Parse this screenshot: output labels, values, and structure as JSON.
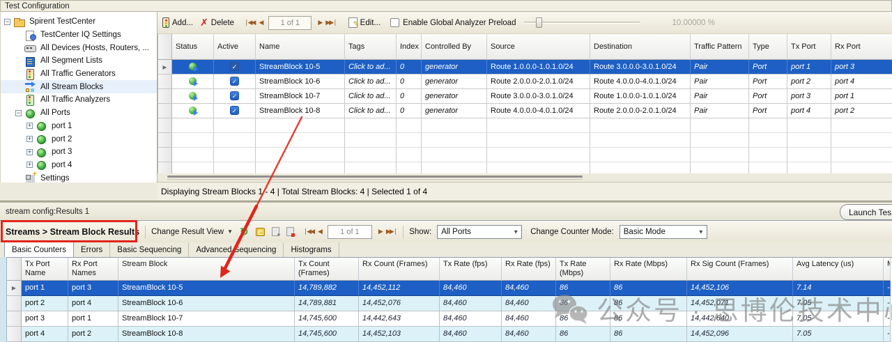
{
  "colors": {
    "selection_blue": "#1d5fc4",
    "alt_row_cyan": "#dcf2f8",
    "annotation_red": "#e1251b",
    "chrome_beige": "#eceadc",
    "watermark_gray": "#7f7f7f",
    "status_green": "#3cb043",
    "checkbox_blue": "#2a6bd0"
  },
  "config_panel": {
    "title": "Test Configuration",
    "tree": {
      "items": [
        {
          "label": "Spirent TestCenter",
          "icon": "folder",
          "level": 0,
          "exp": "minus",
          "selected": false
        },
        {
          "label": "TestCenter IQ Settings",
          "icon": "docgear",
          "level": 1,
          "exp": "",
          "selected": false
        },
        {
          "label": "All Devices (Hosts, Routers, ...",
          "icon": "devices",
          "level": 1,
          "exp": "",
          "selected": false
        },
        {
          "label": "All Segment Lists",
          "icon": "segments",
          "level": 1,
          "exp": "",
          "selected": false
        },
        {
          "label": "All Traffic Generators",
          "icon": "traffic",
          "level": 1,
          "exp": "",
          "selected": false
        },
        {
          "label": "All Stream Blocks",
          "icon": "stream",
          "level": 1,
          "exp": "",
          "selected": true
        },
        {
          "label": "All Traffic Analyzers",
          "icon": "analyzer",
          "level": 1,
          "exp": "",
          "selected": false
        },
        {
          "label": "All Ports",
          "icon": "port",
          "level": 1,
          "exp": "minus",
          "selected": false
        },
        {
          "label": "port 1",
          "icon": "port",
          "level": 2,
          "exp": "plus",
          "selected": false
        },
        {
          "label": "port 2",
          "icon": "port",
          "level": 2,
          "exp": "plus",
          "selected": false
        },
        {
          "label": "port 3",
          "icon": "port",
          "level": 2,
          "exp": "plus",
          "selected": false
        },
        {
          "label": "port 4",
          "icon": "port",
          "level": 2,
          "exp": "plus",
          "selected": false
        },
        {
          "label": "Settings",
          "icon": "settings",
          "level": 1,
          "exp": "",
          "selected": false
        }
      ]
    },
    "toolbar": {
      "add_label": "Add...",
      "delete_label": "Delete",
      "page": "1 of 1",
      "edit_label": "Edit...",
      "preload_label": "Enable Global Analyzer Preload",
      "percent": "10.00000 %"
    },
    "table": {
      "columns": [
        "Status",
        "Active",
        "Name",
        "Tags",
        "Index",
        "Controlled By",
        "Source",
        "Destination",
        "Traffic Pattern",
        "Type",
        "Tx Port",
        "Rx Port"
      ],
      "rows": [
        {
          "name": "StreamBlock 10-5",
          "tags": "Click to ad...",
          "index": "0",
          "controlled_by": "generator",
          "source": "Route 1.0.0.0-1.0.1.0/24",
          "destination": "Route 3.0.0.0-3.0.1.0/24",
          "pattern": "Pair",
          "type": "Port",
          "tx_port": "port 1",
          "rx_port": "port 3",
          "active": true,
          "selected": true
        },
        {
          "name": "StreamBlock 10-6",
          "tags": "Click to ad...",
          "index": "0",
          "controlled_by": "generator",
          "source": "Route 2.0.0.0-2.0.1.0/24",
          "destination": "Route 4.0.0.0-4.0.1.0/24",
          "pattern": "Pair",
          "type": "Port",
          "tx_port": "port 2",
          "rx_port": "port 4",
          "active": true,
          "selected": false
        },
        {
          "name": "StreamBlock 10-7",
          "tags": "Click to ad...",
          "index": "0",
          "controlled_by": "generator",
          "source": "Route 3.0.0.0-3.0.1.0/24",
          "destination": "Route 1.0.0.0-1.0.1.0/24",
          "pattern": "Pair",
          "type": "Port",
          "tx_port": "port 3",
          "rx_port": "port 1",
          "active": true,
          "selected": false
        },
        {
          "name": "StreamBlock 10-8",
          "tags": "Click to ad...",
          "index": "0",
          "controlled_by": "generator",
          "source": "Route 4.0.0.0-4.0.1.0/24",
          "destination": "Route 2.0.0.0-2.0.1.0/24",
          "pattern": "Pair",
          "type": "Port",
          "tx_port": "port 4",
          "rx_port": "port 2",
          "active": true,
          "selected": false
        }
      ]
    },
    "status_text": "Displaying Stream Blocks 1 - 4  |  Total Stream Blocks: 4  |  Selected 1 of 4"
  },
  "results_panel": {
    "title": "stream config:Results 1",
    "launch_button": "Launch Tes",
    "toolbar": {
      "breadcrumb": "Streams > Stream Block Results",
      "change_view": "Change Result View",
      "page": "1 of 1",
      "show_label": "Show:",
      "show_value": "All Ports",
      "counter_label": "Change Counter Mode:",
      "counter_value": "Basic Mode"
    },
    "tabs": [
      "Basic Counters",
      "Errors",
      "Basic Sequencing",
      "Advanced Sequencing",
      "Histograms"
    ],
    "active_tab": "Basic Counters",
    "table": {
      "columns": [
        "Tx Port Name",
        "Rx Port Names",
        "Stream Block",
        "Tx Count (Frames)",
        "Rx Count (Frames)",
        "Tx Rate (fps)",
        "Rx Rate (fps)",
        "Tx Rate (Mbps)",
        "Rx Rate (Mbps)",
        "Rx Sig Count (Frames)",
        "Avg Latency (us)",
        "M"
      ],
      "rows": [
        [
          "port 1",
          "port 3",
          "StreamBlock 10-5",
          "14,789,882",
          "14,452,112",
          "84,460",
          "84,460",
          "86",
          "86",
          "14,452,106",
          "7.14",
          "-"
        ],
        [
          "port 2",
          "port 4",
          "StreamBlock 10-6",
          "14,789,881",
          "14,452,076",
          "84,460",
          "84,460",
          "86",
          "86",
          "14,452,071",
          "7.05",
          "-"
        ],
        [
          "port 3",
          "port 1",
          "StreamBlock 10-7",
          "14,745,600",
          "14,442,643",
          "84,460",
          "84,460",
          "86",
          "86",
          "14,442,640",
          "7.05",
          "-"
        ],
        [
          "port 4",
          "port 2",
          "StreamBlock 10-8",
          "14,745,600",
          "14,452,103",
          "84,460",
          "84,460",
          "86",
          "86",
          "14,452,096",
          "7.05",
          "-"
        ]
      ]
    }
  },
  "watermark": "公众号 · 思博伦技术中心"
}
